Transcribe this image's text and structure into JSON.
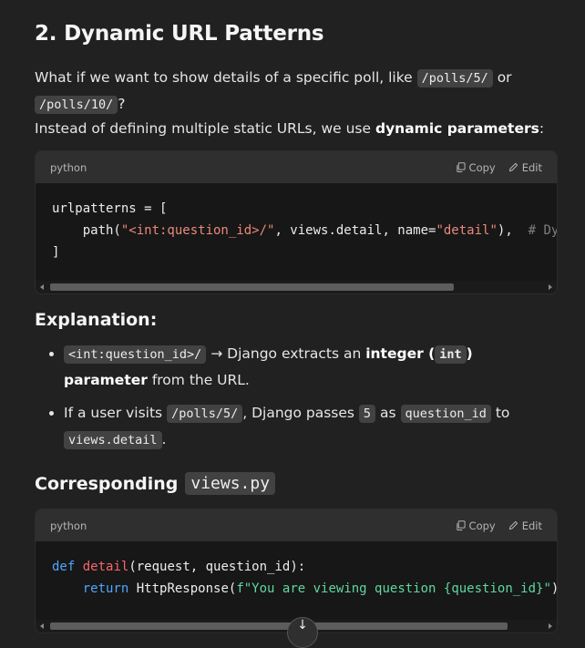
{
  "section": {
    "heading": "2. Dynamic URL Patterns",
    "intro_text_1": "What if we want to show details of a specific poll, like ",
    "intro_code_1": "/polls/5/",
    "intro_text_2": " or ",
    "intro_code_2": "/polls/10/",
    "intro_text_3": "?",
    "line2_text_1": "Instead of defining multiple static URLs, we use ",
    "line2_bold": "dynamic parameters",
    "line2_text_2": ":"
  },
  "codeblock1": {
    "language": "python",
    "copy_label": "Copy",
    "edit_label": "Edit",
    "l1": "urlpatterns = [",
    "l2_a": "    path(",
    "l2_str1": "\"<int:question_id>/\"",
    "l2_b": ", views.detail, name=",
    "l2_str2": "\"detail\"",
    "l2_c": "),  ",
    "l2_comment": "# Dy",
    "l3": "]"
  },
  "explanation": {
    "heading": "Explanation:",
    "b1_code": "<int:question_id>/",
    "b1_text_1": " → Django extracts an ",
    "b1_bold_1": "integer (",
    "b1_code_2": "int",
    "b1_bold_2": ") parameter",
    "b1_text_2": " from the URL.",
    "b2_text_1": "If a user visits ",
    "b2_code_1": "/polls/5/",
    "b2_text_2": ", Django passes ",
    "b2_code_2": "5",
    "b2_text_3": " as ",
    "b2_code_3": "question_id",
    "b2_text_4": " to ",
    "b2_code_4": "views.detail",
    "b2_text_5": "."
  },
  "corresponding": {
    "heading": "Corresponding",
    "code": "views.py"
  },
  "codeblock2": {
    "language": "python",
    "copy_label": "Copy",
    "edit_label": "Edit",
    "l1_kw": "def",
    "l1_fn": " detail",
    "l1_rest": "(request, question_id):",
    "l2_a": "    ",
    "l2_kw": "return",
    "l2_b": " HttpResponse(",
    "l2_fstr": "f\"You are viewing question {question_id}\"",
    "l2_c": ")"
  },
  "icons": {
    "copy": "copy-icon",
    "edit": "edit-icon",
    "scroll_down": "arrow-down-icon"
  },
  "scroll": {
    "codeblock1_thumb_fraction": 0.82,
    "codeblock2_thumb_fraction": 0.93
  }
}
